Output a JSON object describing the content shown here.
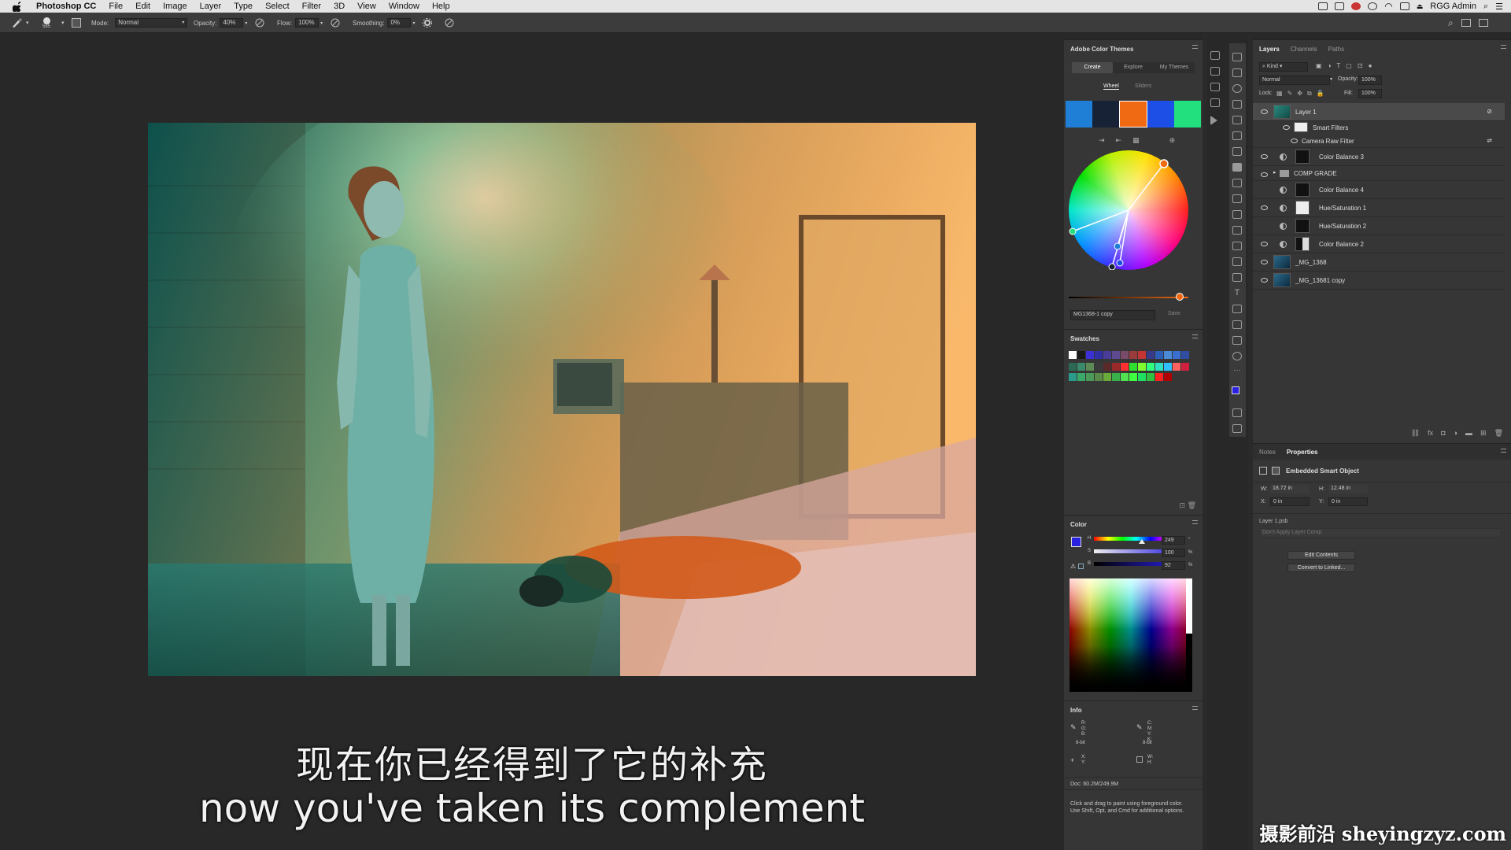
{
  "menubar": {
    "app_name": "Photoshop CC",
    "items": [
      "File",
      "Edit",
      "Image",
      "Layer",
      "Type",
      "Select",
      "Filter",
      "3D",
      "View",
      "Window",
      "Help"
    ],
    "user": "RGG Admin"
  },
  "options_bar": {
    "brush_size": "585",
    "mode_label": "Mode:",
    "mode_value": "Normal",
    "opacity_label": "Opacity:",
    "opacity_value": "40%",
    "flow_label": "Flow:",
    "flow_value": "100%",
    "smoothing_label": "Smoothing:",
    "smoothing_value": "0%"
  },
  "color_themes": {
    "title": "Adobe Color Themes",
    "tabs": [
      "Create",
      "Explore",
      "My Themes"
    ],
    "subtabs": [
      "Wheel",
      "Sliders"
    ],
    "swatches": [
      "#1f7fd6",
      "#182236",
      "#f06a14",
      "#1d4fe6",
      "#22e07e"
    ],
    "theme_name": "MG1368-1 copy",
    "save_label": "Save"
  },
  "swatches": {
    "title": "Swatches",
    "row1": [
      "#ffffff",
      "#1a1a1a",
      "#3b2fd6",
      "#2f2fa8",
      "#4a3d9a",
      "#5d4a8f",
      "#7a4a6a",
      "#9a3a3a",
      "#c43434",
      "#3a3a8a",
      "#2d5fb8",
      "#4b8ad4",
      "#3a6fcf",
      "#2f4ea3"
    ],
    "row2": [
      "#2d6a55",
      "#3b8a6c",
      "#5d8a55",
      "#3a3a3a",
      "#5a2a2a",
      "#9a2a2a",
      "#ff3030",
      "#30e030",
      "#80ff30",
      "#30ff80",
      "#30e0c0",
      "#30c0ff",
      "#ff6060",
      "#d02040"
    ],
    "row3": [
      "#2a9a8a",
      "#3aaa6a",
      "#4a9a5a",
      "#5a8a4a",
      "#6aaa3a",
      "#3ab04a",
      "#50e050",
      "#40ff40",
      "#20e060",
      "#30c040",
      "#ff2020",
      "#b00000"
    ]
  },
  "color_panel": {
    "title": "Color",
    "h_value": "249",
    "s_value": "100",
    "b_value": "92",
    "h_unit": "°",
    "s_unit": "%",
    "b_unit": "%",
    "h_label": "H",
    "s_label": "S",
    "b_label": "B"
  },
  "info_panel": {
    "title": "Info",
    "r_label": "R:",
    "g_label": "G:",
    "b_label": "B:",
    "c_label": "C:",
    "m_label": "M:",
    "y_label": "Y:",
    "k_label": "K:",
    "bit_left": "8-bit",
    "bit_right": "8-bit",
    "x_label": "X:",
    "yy_label": "Y:",
    "w_label": "W:",
    "h_label": "H:",
    "doc": "Doc: 60.2M/249.9M",
    "hint": "Click and drag to paint using foreground color. Use Shift, Opt, and Cmd for additional options."
  },
  "layers_panel": {
    "tabs": [
      "Layers",
      "Channels",
      "Paths"
    ],
    "kind_label": "Kind",
    "blend_mode": "Normal",
    "opacity_label": "Opacity:",
    "opacity_value": "100%",
    "lock_label": "Lock:",
    "fill_label": "Fill:",
    "fill_value": "100%",
    "layers": [
      {
        "name": "Layer 1",
        "visible": true
      },
      {
        "name": "Smart Filters",
        "visible": true
      },
      {
        "name": "Camera Raw Filter",
        "visible": true
      },
      {
        "name": "Color Balance 3",
        "visible": true
      },
      {
        "name": "COMP GRADE",
        "visible": true
      },
      {
        "name": "Color Balance 4",
        "visible": false
      },
      {
        "name": "Hue/Saturation 1",
        "visible": true
      },
      {
        "name": "Hue/Saturation 2",
        "visible": false
      },
      {
        "name": "Color Balance 2",
        "visible": true
      },
      {
        "name": "_MG_1368",
        "visible": true
      },
      {
        "name": "_MG_13681 copy",
        "visible": true
      }
    ]
  },
  "properties_panel": {
    "tabs": [
      "Notes",
      "Properties"
    ],
    "type_label": "Embedded Smart Object",
    "w_label": "W:",
    "w_value": "18.72 in",
    "h_label": "H:",
    "h_value": "12.48 in",
    "x_label": "X:",
    "x_value": "0 in",
    "y_label": "Y:",
    "y_value": "0 in",
    "file": "Layer 1.psb",
    "comp_placeholder": "Don't Apply Layer Comp",
    "edit_button": "Edit Contents",
    "convert_button": "Convert to Linked..."
  },
  "subtitles": {
    "chinese": "现在你已经得到了它的补充",
    "english": "now you've taken its complement"
  },
  "watermark": "摄影前沿 sheyingzyz.com"
}
